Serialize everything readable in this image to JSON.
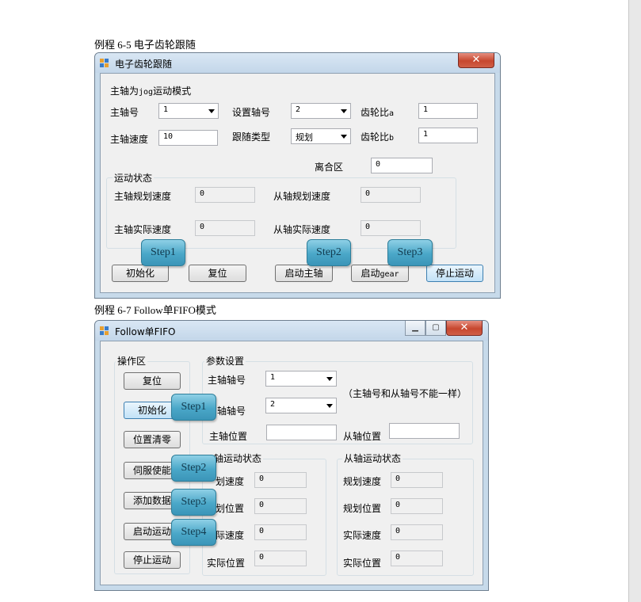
{
  "captions": {
    "c1": "例程  6-5  电子齿轮跟随",
    "c2": "例程  6-7 Follow单FIFO模式"
  },
  "colors": {
    "step_fill": "#4aa7c8",
    "titlebar": "#c7daea",
    "close_button": "#c7472f"
  },
  "win1": {
    "title": "电子齿轮跟随",
    "close_glyph": "✕",
    "mode_label_prefix": "主轴为",
    "mode_label_code": "jog",
    "mode_label_suffix": "运动模式",
    "master_axis_label": "主轴号",
    "master_axis_value": "1",
    "set_axis_label": "设置轴号",
    "set_axis_value": "2",
    "ratio_a_label": "齿轮比a",
    "ratio_a_value": "1",
    "master_speed_label": "主轴速度",
    "master_speed_value": "10",
    "follow_type_label": "跟随类型",
    "follow_type_value": "规划",
    "ratio_b_label": "齿轮比b",
    "ratio_b_value": "1",
    "clutch_label": "离合区",
    "clutch_value": "0",
    "status_group": "运动状态",
    "master_plan_speed_label": "主轴规划速度",
    "master_plan_speed_value": "0",
    "slave_plan_speed_label": "从轴规划速度",
    "slave_plan_speed_value": "0",
    "master_actual_speed_label": "主轴实际速度",
    "master_actual_speed_value": "0",
    "slave_actual_speed_label": "从轴实际速度",
    "slave_actual_speed_value": "0",
    "init_button": "初始化",
    "reset_button": "复位",
    "start_master_button": "启动主轴",
    "start_gear_prefix": "启动",
    "start_gear_code": "gear",
    "stop_button": "停止运动",
    "steps": [
      "Step1",
      "Step2",
      "Step3"
    ]
  },
  "win2": {
    "title": "Follow单FIFO",
    "min_glyph": "▁",
    "max_glyph": "▢",
    "close_glyph": "✕",
    "ops_group": "操作区",
    "reset_button": "复位",
    "init_button": "初始化",
    "zero_button": "位置清零",
    "servo_button": "伺服使能",
    "add_data_button": "添加数据",
    "start_button": "启动运动",
    "stop_button": "停止运动",
    "params_group": "参数设置",
    "master_axis_label": "主轴轴号",
    "master_axis_value": "1",
    "slave_axis_label": "轴轴号",
    "slave_axis_value": "2",
    "note": "（主轴号和从轴号不能一样）",
    "master_pos_label": "主轴位置",
    "master_pos_value": "",
    "slave_pos_label": "从轴位置",
    "slave_pos_value": "",
    "master_status_group": "轴运动状态",
    "slave_status_group": "从轴运动状态",
    "m_plan_speed_label": "划速度",
    "m_plan_speed_value": "0",
    "m_plan_pos_label": "划位置",
    "m_plan_pos_value": "0",
    "m_actual_speed_label": "际速度",
    "m_actual_speed_value": "0",
    "m_actual_pos_label": "实际位置",
    "m_actual_pos_value": "0",
    "s_plan_speed_label": "规划速度",
    "s_plan_speed_value": "0",
    "s_plan_pos_label": "规划位置",
    "s_plan_pos_value": "0",
    "s_actual_speed_label": "实际速度",
    "s_actual_speed_value": "0",
    "s_actual_pos_label": "实际位置",
    "s_actual_pos_value": "0",
    "steps": [
      "Step1",
      "Step2",
      "Step3",
      "Step4"
    ]
  }
}
